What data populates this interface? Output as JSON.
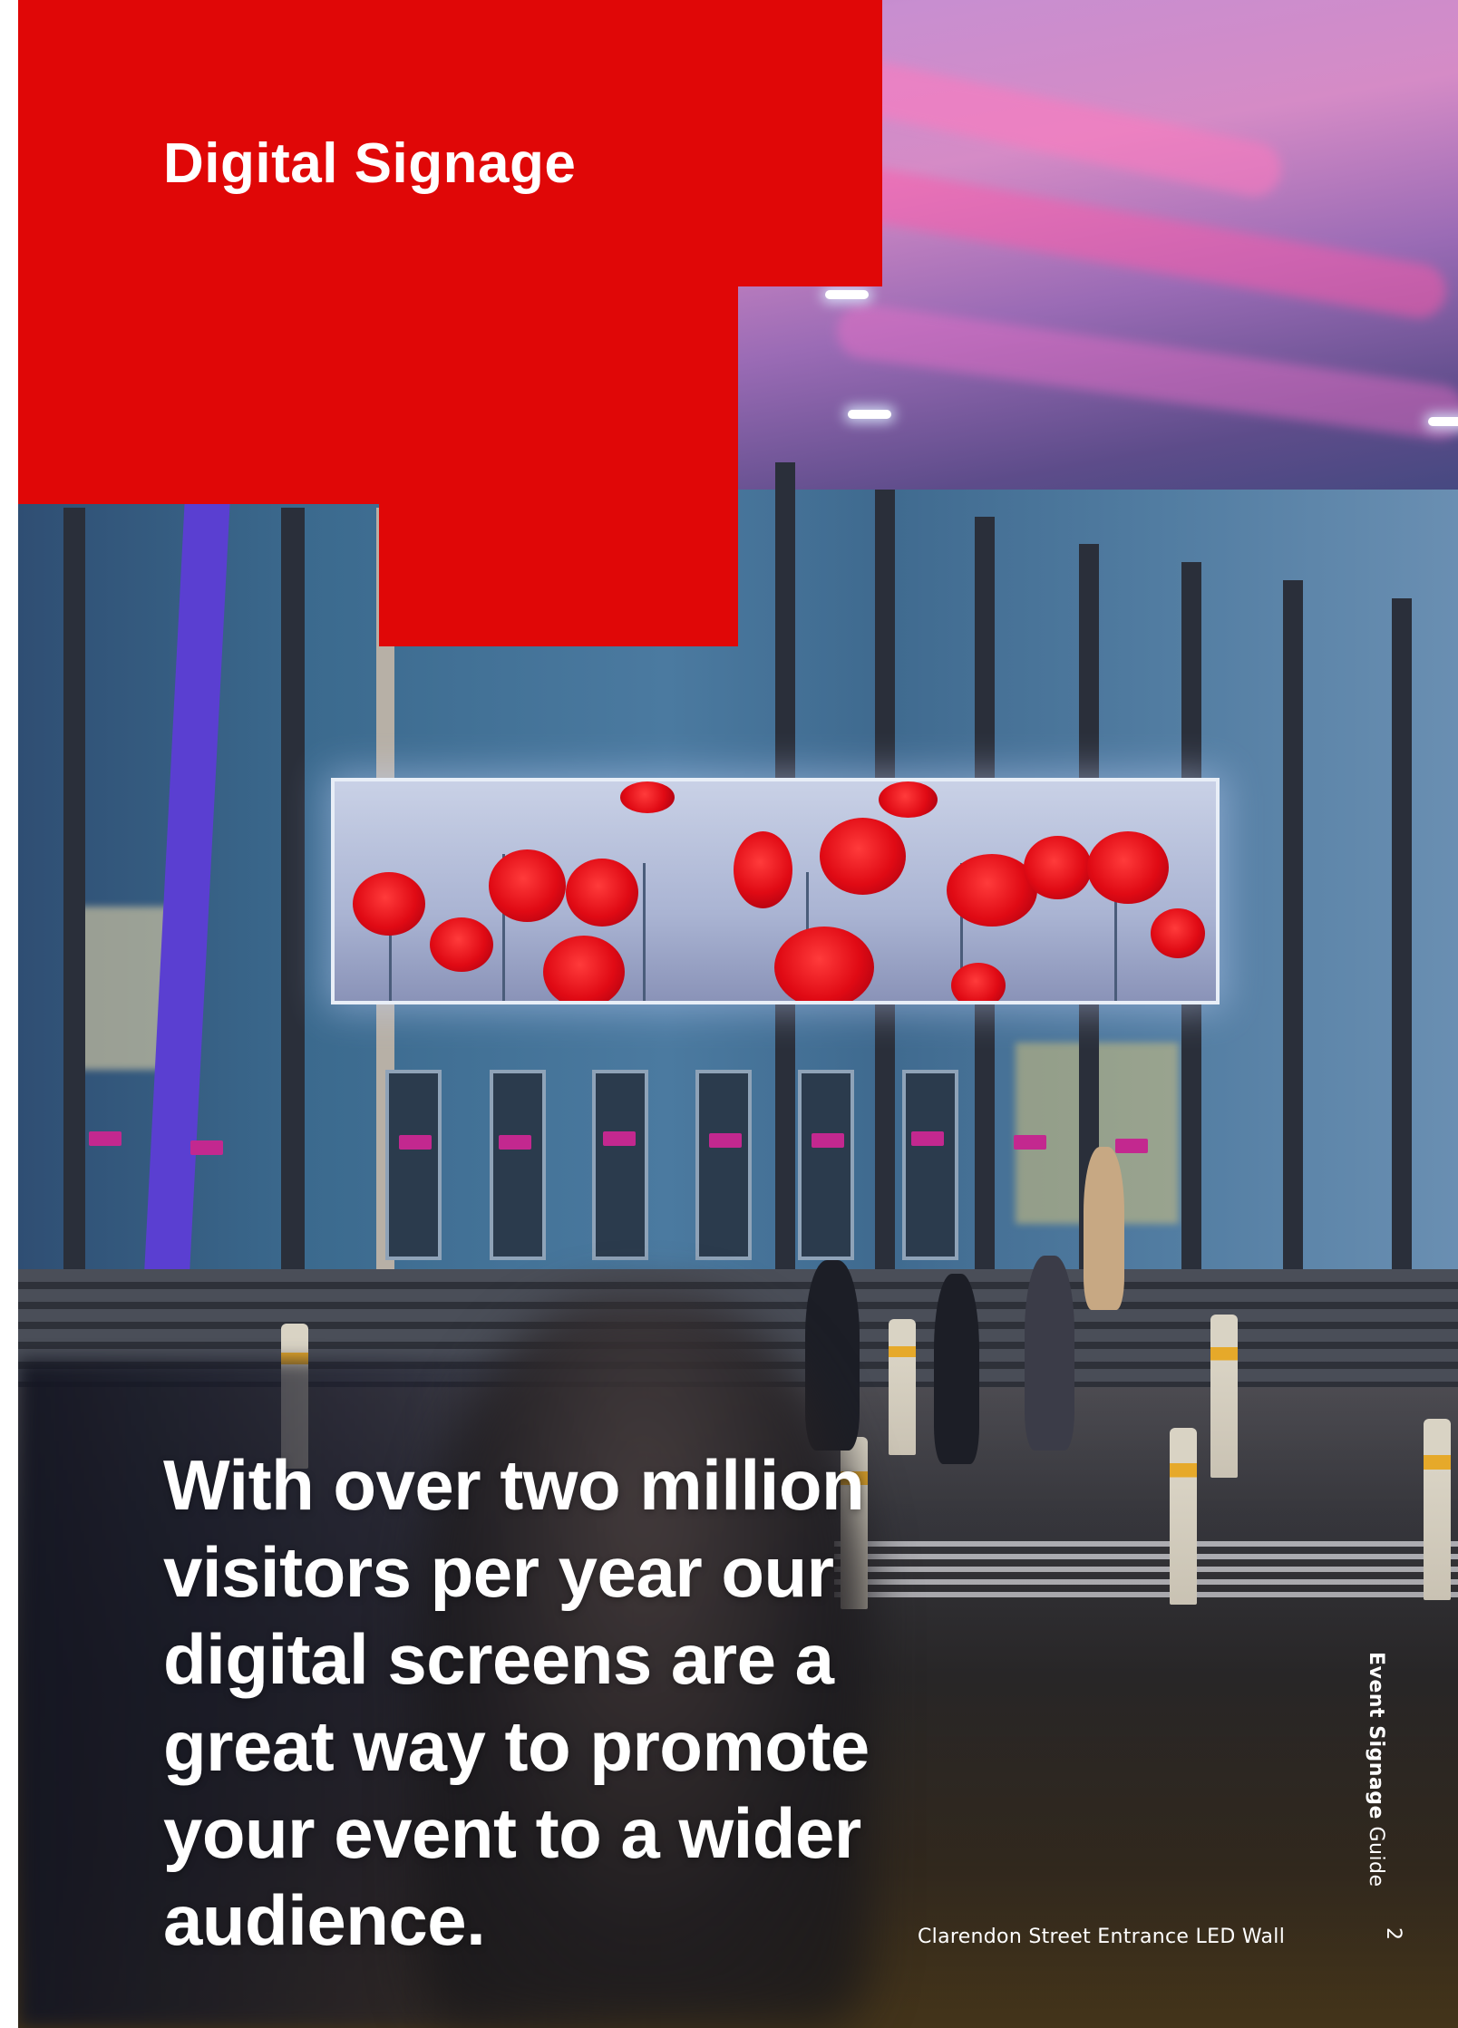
{
  "page": {
    "title": "Digital Signage",
    "headline_lines": [
      "With over two million",
      "visitors per year our",
      "digital screens are a",
      "great way to promote",
      "your event to a wider",
      "audience."
    ],
    "photo_caption": "Clarendon Street Entrance LED Wall",
    "side_label": {
      "bold": "Event Signage",
      "regular": "Guide"
    },
    "page_number": "2"
  },
  "colors": {
    "brand_red": "#e00707",
    "text": "#ffffff"
  }
}
